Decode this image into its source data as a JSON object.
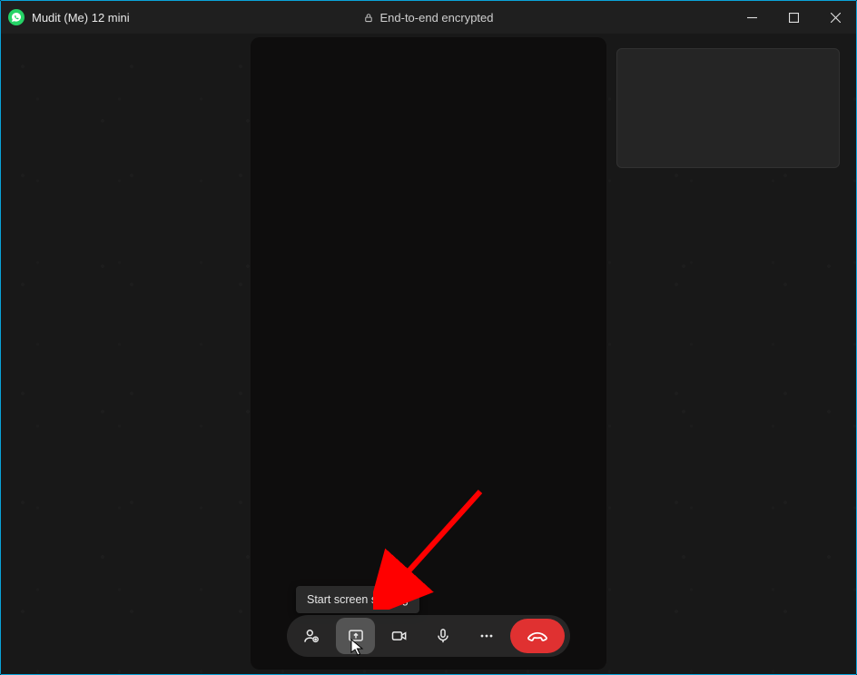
{
  "titlebar": {
    "window_title": "Mudit (Me) 12 mini",
    "encryption_label": "End-to-end encrypted"
  },
  "tooltip": {
    "screen_share": "Start screen sharing"
  },
  "colors": {
    "whatsapp_green": "#25d366",
    "end_call_red": "#e03131",
    "tooltip_bg": "#2a2a2a"
  }
}
